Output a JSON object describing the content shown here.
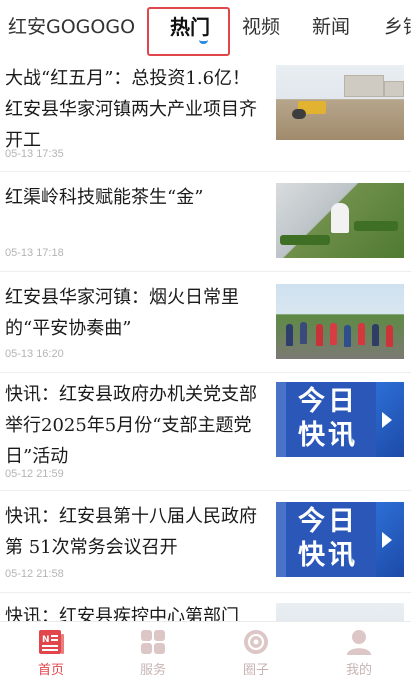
{
  "channel_tabs": [
    "红安GOGOGO",
    "热门",
    "视频",
    "新闻",
    "乡镇"
  ],
  "active_tab": "热门",
  "feed": [
    {
      "title": "大战“红五月”：总投资1.6亿！红安县华家河镇两大产业项目齐开工",
      "date": "05-13 17:35",
      "thumb": "construction-photo"
    },
    {
      "title": "红渠岭科技赋能茶生“金”",
      "date": "05-13 17:18",
      "thumb": "tea-factory-photo"
    },
    {
      "title": "红安县华家河镇：烟火日常里的“平安协奏曲”",
      "date": "05-13 16:20",
      "thumb": "community-event-photo"
    },
    {
      "title": "快讯：红安县政府办机关党支部举行2025年5月份“支部主题党日”活动",
      "date": "05-12 21:59",
      "thumb": "flash-news-banner"
    },
    {
      "title": "快讯：红安县第十八届人民政府第 51次常务会议召开",
      "date": "05-12 21:58",
      "thumb": "flash-news-banner"
    },
    {
      "title": "快讯：红安县疾控中心第部门",
      "date": "",
      "thumb": "photo"
    }
  ],
  "banner_text": {
    "line1": "今日",
    "line2": "快讯"
  },
  "bottom_nav": [
    {
      "label": "首页",
      "icon": "home-news-icon",
      "active": true
    },
    {
      "label": "服务",
      "icon": "services-grid-icon",
      "active": false
    },
    {
      "label": "圈子",
      "icon": "circle-icon",
      "active": false
    },
    {
      "label": "我的",
      "icon": "profile-icon",
      "active": false
    }
  ],
  "colors": {
    "accent": "#e0464a",
    "highlight_box": "#e0464a",
    "tab_indicator": "#2f8ce0",
    "banner_blue": "#2a57b8",
    "nav_inactive": "#c8b4b4"
  }
}
